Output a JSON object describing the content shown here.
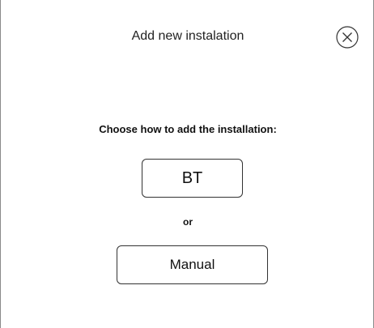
{
  "dialog": {
    "title": "Add new instalation",
    "close_icon": "close-circle-icon",
    "prompt": "Choose how to add the installation:",
    "options": {
      "bt_label": "BT",
      "separator": "or",
      "manual_label": "Manual"
    }
  },
  "colors": {
    "background": "#ffffff",
    "border": "#333333",
    "text": "#111111"
  }
}
